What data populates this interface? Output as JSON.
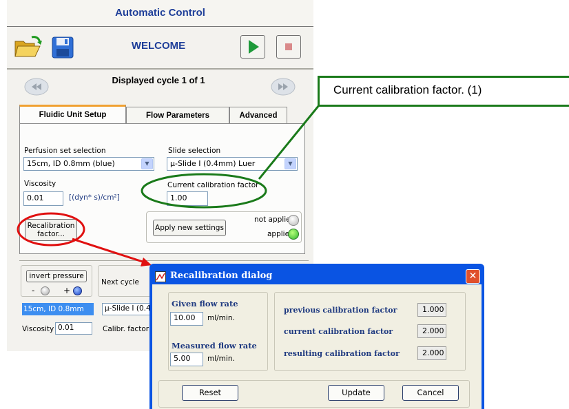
{
  "app": {
    "title": "Automatic Control",
    "welcome": "WELCOME",
    "cycle_label": "Displayed cycle 1 of 1"
  },
  "tabs": [
    {
      "label": "Fluidic Unit Setup",
      "active": true
    },
    {
      "label": "Flow Parameters",
      "active": false
    },
    {
      "label": "Advanced",
      "active": false
    }
  ],
  "setup": {
    "perfusion_label": "Perfusion set selection",
    "perfusion_value": "15cm, ID 0.8mm (blue)",
    "slide_label": "Slide selection",
    "slide_value": "µ-Slide I (0.4mm) Luer",
    "viscosity_label": "Viscosity",
    "viscosity_value": "0.01",
    "viscosity_unit": "[(dyn* s)/cm²]",
    "calib_label": "Current calibration factor",
    "calib_value": "1.00",
    "recalib_line1": "Recalibration",
    "recalib_line2": "factor...",
    "apply_label": "Apply new settings",
    "not_applied": "not applied",
    "applied": "applied"
  },
  "bottom": {
    "invert_label": "invert pressure",
    "minus": "-",
    "plus": "+",
    "next_cycle": "Next cycle",
    "perfusion_short": "15cm, ID 0.8mm",
    "slide_short": "µ-Slide I (0.4",
    "viscosity_label": "Viscosity",
    "viscosity_value": "0.01",
    "calib_label": "Calibr. factor"
  },
  "callout": {
    "text": "Current calibration factor. (1)"
  },
  "dialog": {
    "title": "Recalibration dialog",
    "given_label": "Given flow rate",
    "given_value": "10.00",
    "given_unit": "ml/min.",
    "measured_label": "Measured flow rate",
    "measured_value": "5.00",
    "measured_unit": "ml/min.",
    "prev_label": "previous calibration factor",
    "prev_value": "1.000",
    "curr_label": "current calibration factor",
    "curr_value": "2.000",
    "result_label": "resulting calibration factor",
    "result_value": "2.000",
    "reset_label": "Reset",
    "update_label": "Update",
    "cancel_label": "Cancel"
  },
  "colors": {
    "title_blue": "#1f3f99",
    "callout_green": "#1a7a1a",
    "annotation_red": "#e01010",
    "dialog_blue": "#0a54e3"
  }
}
